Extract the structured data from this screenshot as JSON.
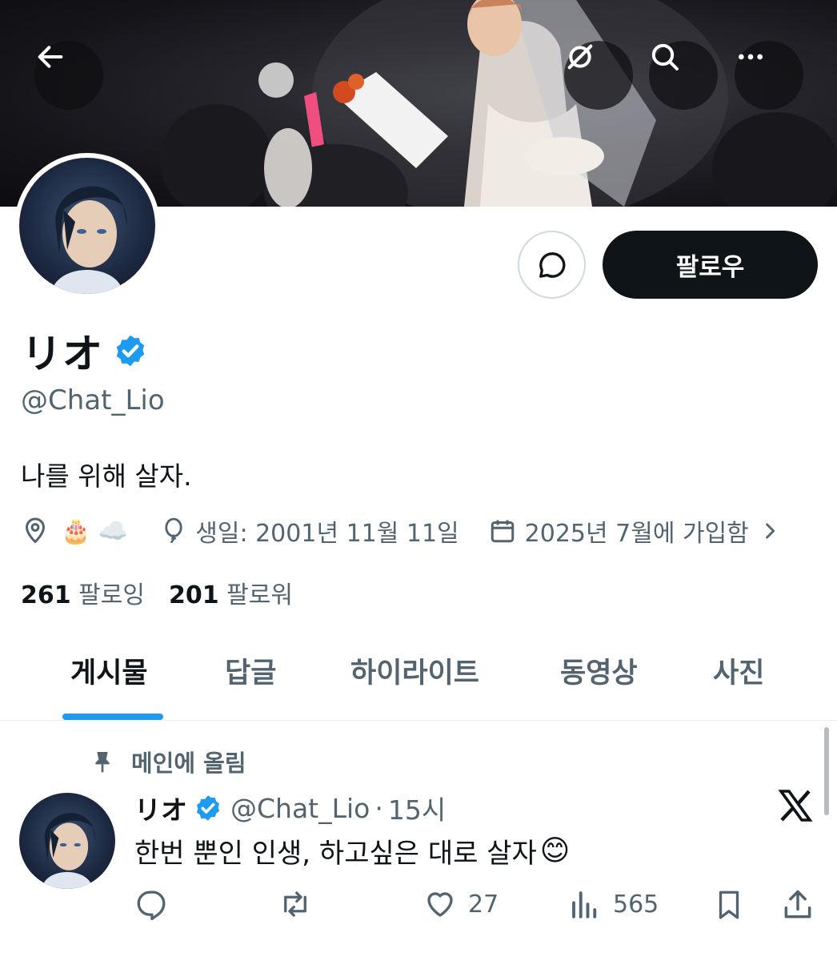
{
  "header": {
    "back_icon": "arrow-left-icon",
    "grok_icon": "grok-icon",
    "search_icon": "search-icon",
    "more_icon": "more-horizontal-icon"
  },
  "profile": {
    "display_name": "リオ",
    "handle": "@Chat_Lio",
    "verified": true,
    "bio": "나를 위해 살자.",
    "location_emojis": "🎂 ☁️",
    "birthday": "생일: 2001년 11월 11일",
    "joined": "2025년 7월에 가입함",
    "following_count": "261",
    "following_label": "팔로잉",
    "followers_count": "201",
    "followers_label": "팔로워",
    "follow_label": "팔로우"
  },
  "tabs": [
    {
      "label": "게시물",
      "active": true
    },
    {
      "label": "답글",
      "active": false
    },
    {
      "label": "하이라이트",
      "active": false
    },
    {
      "label": "동영상",
      "active": false
    },
    {
      "label": "사진",
      "active": false
    }
  ],
  "post": {
    "pinned_label": "메인에 올림",
    "author_name": "リオ",
    "author_handle": "@Chat_Lio",
    "separator": "·",
    "time": "15시",
    "text": "한번 뿐인 인생, 하고싶은 대로 살자",
    "emoji": "😊",
    "likes": "27",
    "views": "565"
  },
  "colors": {
    "accent": "#1d9bf0",
    "text": "#0f1419",
    "secondary": "#536471",
    "verified": "#1d9bf0"
  }
}
